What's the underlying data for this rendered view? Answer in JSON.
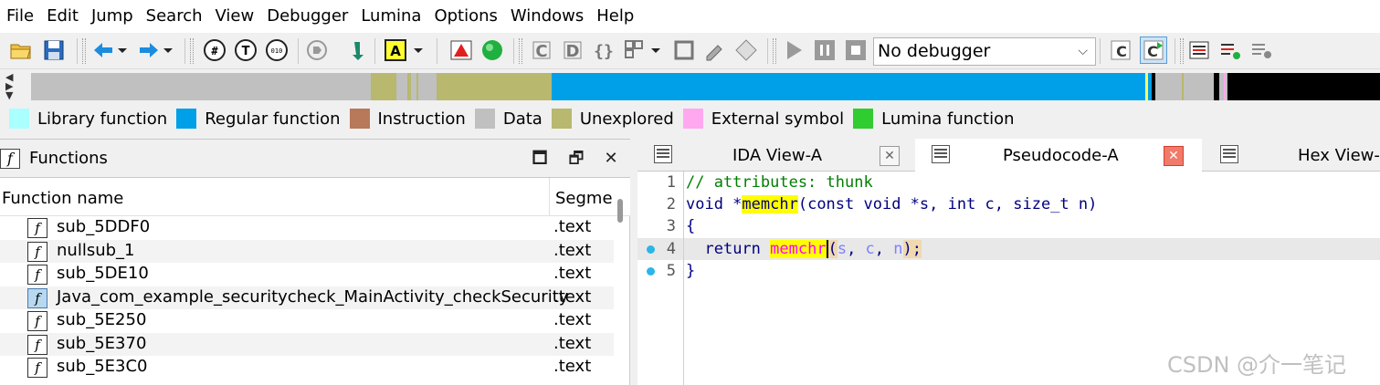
{
  "menu": [
    "File",
    "Edit",
    "Jump",
    "Search",
    "View",
    "Debugger",
    "Lumina",
    "Options",
    "Windows",
    "Help"
  ],
  "toolbar": {
    "debugger_select_value": "No debugger",
    "icons": [
      "open-folder-icon",
      "save-icon",
      "back-arrow-icon",
      "forward-arrow-icon",
      "hex-icon",
      "text-icon",
      "binary-icon",
      "run-to-icon",
      "jump-down-icon",
      "highlight-text-icon",
      "mark-red-icon",
      "green-circle-icon",
      "code-icon",
      "data-icon",
      "struct-icon",
      "array-icon",
      "undefine-icon",
      "rename-icon",
      "diamond-icon",
      "play-icon",
      "pause-icon",
      "stop-icon",
      "c-icon",
      "c-green-icon",
      "list-red-icon",
      "list-add-icon",
      "list-settings-icon"
    ]
  },
  "legend": [
    {
      "label": "Library function",
      "color": "#aaffff"
    },
    {
      "label": "Regular function",
      "color": "#00a0e8"
    },
    {
      "label": "Instruction",
      "color": "#b8785a"
    },
    {
      "label": "Data",
      "color": "#c0c0c0"
    },
    {
      "label": "Unexplored",
      "color": "#b8b86e"
    },
    {
      "label": "External symbol",
      "color": "#ffa8f0"
    },
    {
      "label": "Lumina function",
      "color": "#30cc30"
    }
  ],
  "functions_panel": {
    "title": "Functions",
    "columns": [
      "Function name",
      "Segmer"
    ],
    "rows": [
      {
        "name": "sub_5DDF0",
        "segment": ".text"
      },
      {
        "name": "nullsub_1",
        "segment": ".text"
      },
      {
        "name": "sub_5DE10",
        "segment": ".text"
      },
      {
        "name": "Java_com_example_securitycheck_MainActivity_checkSecurity",
        "segment": ".text"
      },
      {
        "name": "sub_5E250",
        "segment": ".text"
      },
      {
        "name": "sub_5E370",
        "segment": ".text"
      },
      {
        "name": "sub_5E3C0",
        "segment": ".text"
      }
    ]
  },
  "tabs": [
    {
      "label": "IDA View-A",
      "active": false
    },
    {
      "label": "Pseudocode-A",
      "active": true
    },
    {
      "label": "Hex View-",
      "active": false
    }
  ],
  "code": {
    "line_numbers": [
      "1",
      "2",
      "3",
      "4",
      "5"
    ],
    "line1": "// attributes: thunk",
    "line2_prefix": "void *",
    "line2_func": "memchr",
    "line2_suffix": "(const void *s, int c, size_t n)",
    "line3": "{",
    "line4_return": "return ",
    "line4_func": "memchr",
    "line4_open": "(",
    "line4_s": "s",
    "line4_sep1": ", ",
    "line4_c": "c",
    "line4_sep2": ", ",
    "line4_n": "n",
    "line4_close": ");",
    "line5": "}"
  },
  "watermark": "CSDN @介一笔记"
}
